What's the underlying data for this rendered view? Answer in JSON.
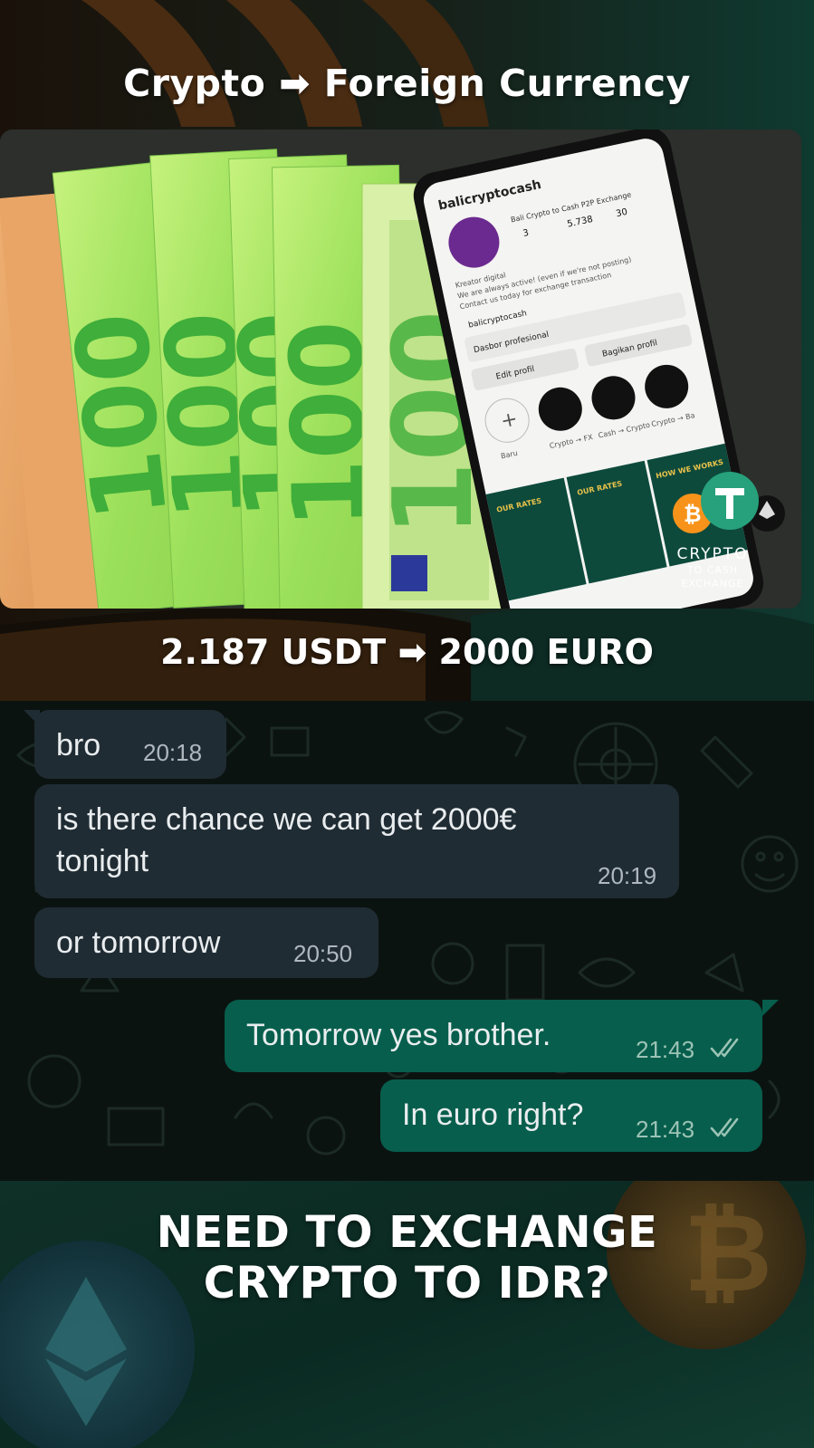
{
  "header": {
    "title": "Crypto ➡ Foreign Currency"
  },
  "caption": {
    "exchange_text": "2.187 USDT ➡ 2000 EURO"
  },
  "photo": {
    "phone": {
      "username": "balicryptocash",
      "bio_title": "Bali Crypto to Cash P2P Exchange",
      "posts": "3",
      "followers": "5.738",
      "following": "30",
      "bio_line1": "Kreator digital",
      "bio_line2": "We are always active! (even if we're not posting)",
      "bio_line3": "Contact us today for exchange transaction",
      "handle": "balicryptocash",
      "dashboard": "Dasbor profesional",
      "edit_profile": "Edit profil",
      "share_profile": "Bagikan profil",
      "highlights": [
        "Baru",
        "Crypto → FX",
        "Cash → Crypto",
        "Crypto → Ba"
      ],
      "grid_labels": [
        "OUR RATES",
        "OUR RATES",
        "HOW WE WORKS"
      ]
    },
    "logo": {
      "line1": "CRYPTO",
      "line2": "TO CASH",
      "line3": "EXCHANGE"
    }
  },
  "chat": {
    "messages": [
      {
        "text": "bro",
        "time": "20:18",
        "direction": "in"
      },
      {
        "text": "is there chance we can get 2000€\ntonight",
        "time": "20:19",
        "direction": "in"
      },
      {
        "text": "or tomorrow",
        "time": "20:50",
        "direction": "in"
      },
      {
        "text": "Tomorrow yes brother.",
        "time": "21:43",
        "direction": "out",
        "status": "read"
      },
      {
        "text": "In euro right?",
        "time": "21:43",
        "direction": "out",
        "status": "read"
      }
    ]
  },
  "footer": {
    "cta_line1": "NEED TO EXCHANGE",
    "cta_line2": "CRYPTO TO IDR?"
  },
  "colors": {
    "incoming_bubble": "#202c33",
    "outgoing_bubble": "#075e4c",
    "banknote_green": "#9be05a",
    "accent_teal": "#26a17b",
    "bitcoin_orange": "#f7931a"
  }
}
